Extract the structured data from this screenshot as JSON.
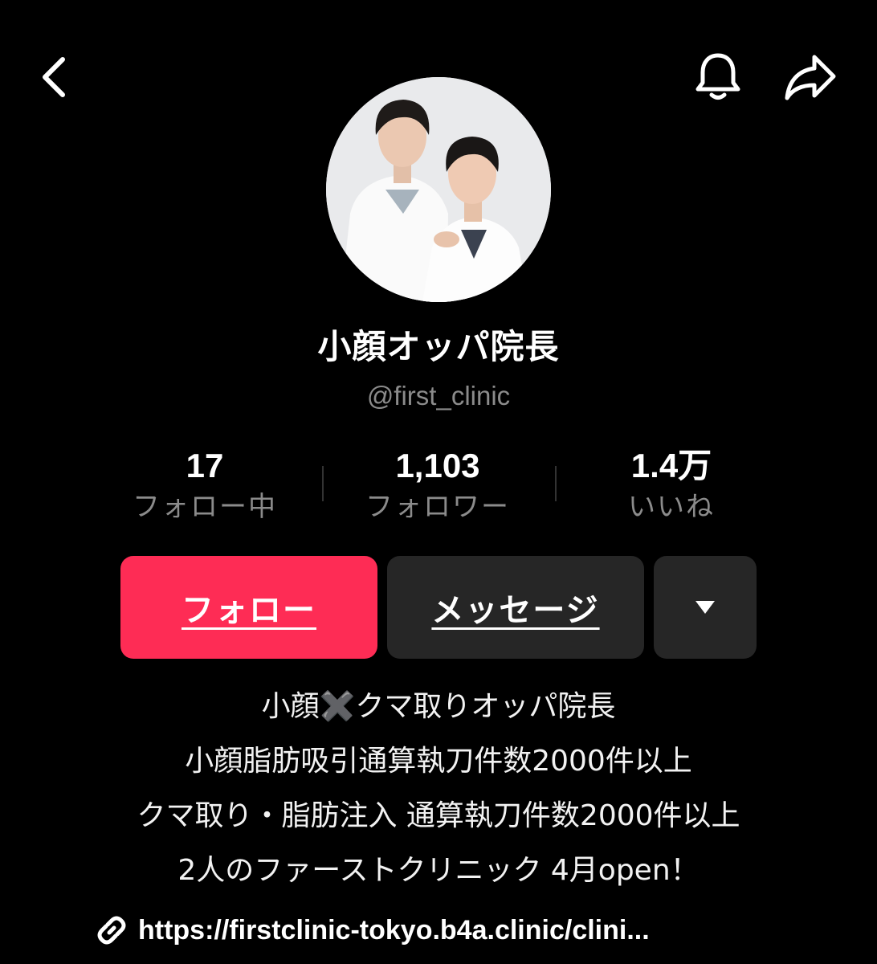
{
  "header": {
    "back_icon": "chevron-left-icon",
    "bell_icon": "bell-icon",
    "share_icon": "share-arrow-icon"
  },
  "profile": {
    "display_name": "小顔オッパ院長",
    "handle": "@first_clinic"
  },
  "stats": [
    {
      "value": "17",
      "label": "フォロー中"
    },
    {
      "value": "1,103",
      "label": "フォロワー"
    },
    {
      "value": "1.4万",
      "label": "いいね"
    }
  ],
  "actions": {
    "follow_label": "フォロー",
    "message_label": "メッセージ",
    "more_icon": "caret-down-icon",
    "follow_color": "#fe2c55",
    "secondary_color": "#262626"
  },
  "bio": {
    "lines": [
      "小顔✖️クマ取りオッパ院長",
      "小顔脂肪吸引通算執刀件数2000件以上",
      "クマ取り・脂肪注入 通算執刀件数2000件以上",
      "2人のファーストクリニック 4月open！"
    ],
    "link_icon": "link-icon",
    "link_text": "https://firstclinic-tokyo.b4a.clinic/clini..."
  }
}
